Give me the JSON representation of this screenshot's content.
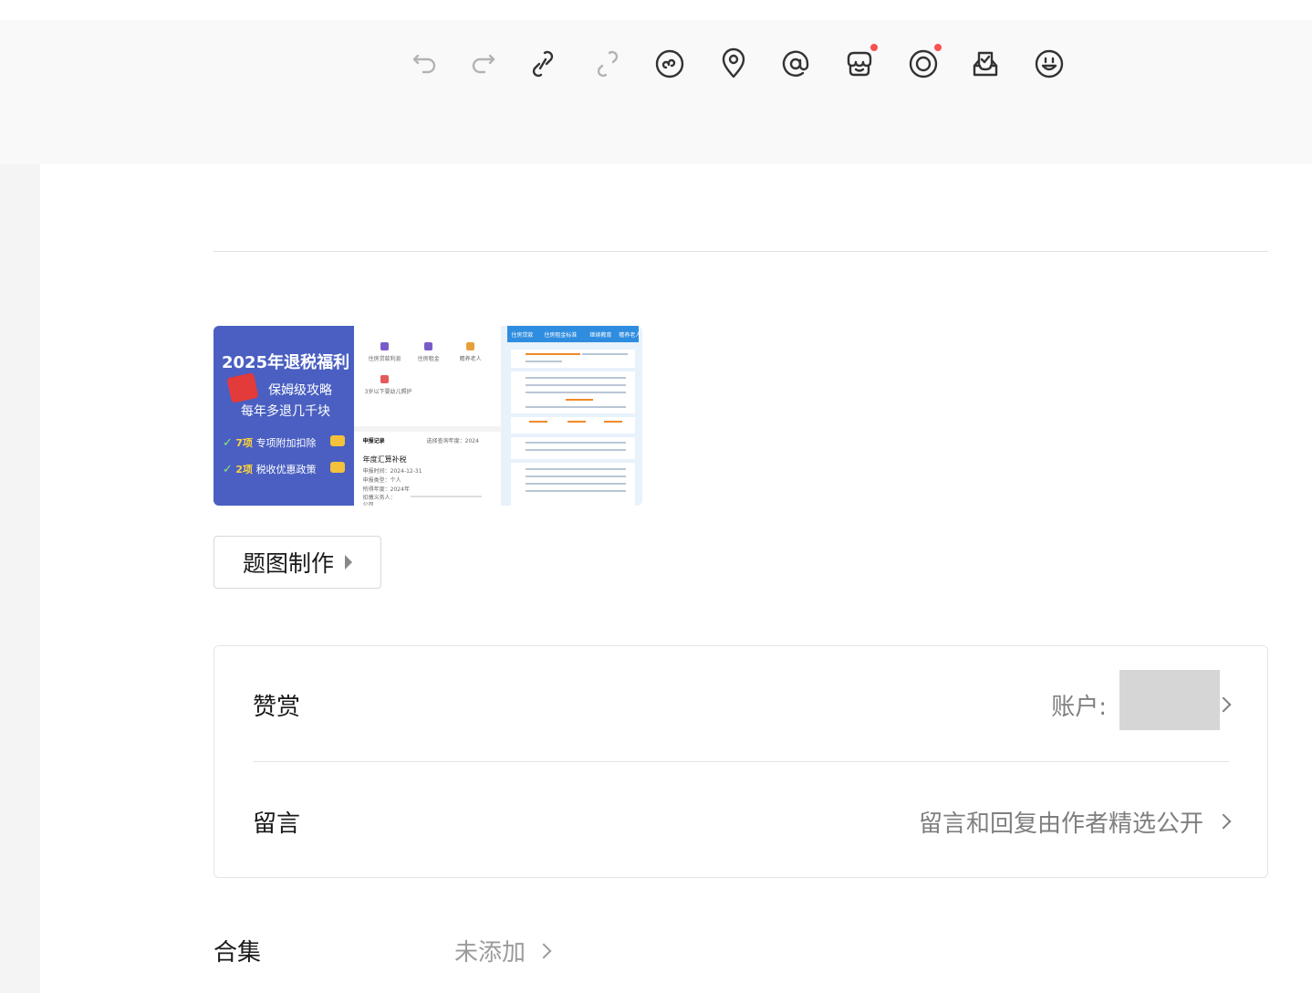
{
  "toolbar": {
    "items": [
      {
        "name": "undo-icon",
        "enabled": false
      },
      {
        "name": "redo-icon",
        "enabled": false
      },
      {
        "name": "link-icon",
        "enabled": true
      },
      {
        "name": "unlink-icon",
        "enabled": false
      },
      {
        "name": "mini-program-icon",
        "enabled": true
      },
      {
        "name": "location-icon",
        "enabled": true
      },
      {
        "name": "mention-icon",
        "enabled": true
      },
      {
        "name": "shop-icon",
        "enabled": true,
        "badge": true
      },
      {
        "name": "channels-icon",
        "enabled": true,
        "badge": true
      },
      {
        "name": "vote-icon",
        "enabled": true
      },
      {
        "name": "emoji-icon",
        "enabled": true
      }
    ],
    "badge_color": "#fa5151"
  },
  "cover": {
    "panel1": {
      "title": "2025年退税福利",
      "line1": "保姆级攻略",
      "line2": "每年多退几千块",
      "item1_num": "7项",
      "item1_text": "专项附加扣除",
      "item2_num": "2项",
      "item2_text": "税收优惠政策",
      "bg_color": "#4a5fc1"
    },
    "panel2": {
      "grid": [
        "住房贷款利息",
        "住房租金",
        "赡养老人",
        "3岁以下婴幼儿照护"
      ],
      "section_title": "申报记录",
      "filter": "选择查询年度：2024",
      "record_title": "年度汇算补税",
      "date": "申报时间：2024-12-31",
      "person": "申报类型：个人",
      "year": "所得年度：2024年",
      "company": "扣缴义务人：",
      "suffix": "公司"
    },
    "panel3": {
      "tabs": [
        "住房贷款",
        "住房租金标准",
        "继续教育",
        "赡养老人"
      ]
    }
  },
  "make_title_label": "题图制作",
  "reward": {
    "label": "赞赏",
    "value": "账户: "
  },
  "comment": {
    "label": "留言",
    "value": "留言和回复由作者精选公开"
  },
  "collection": {
    "label": "合集",
    "value": "未添加"
  }
}
